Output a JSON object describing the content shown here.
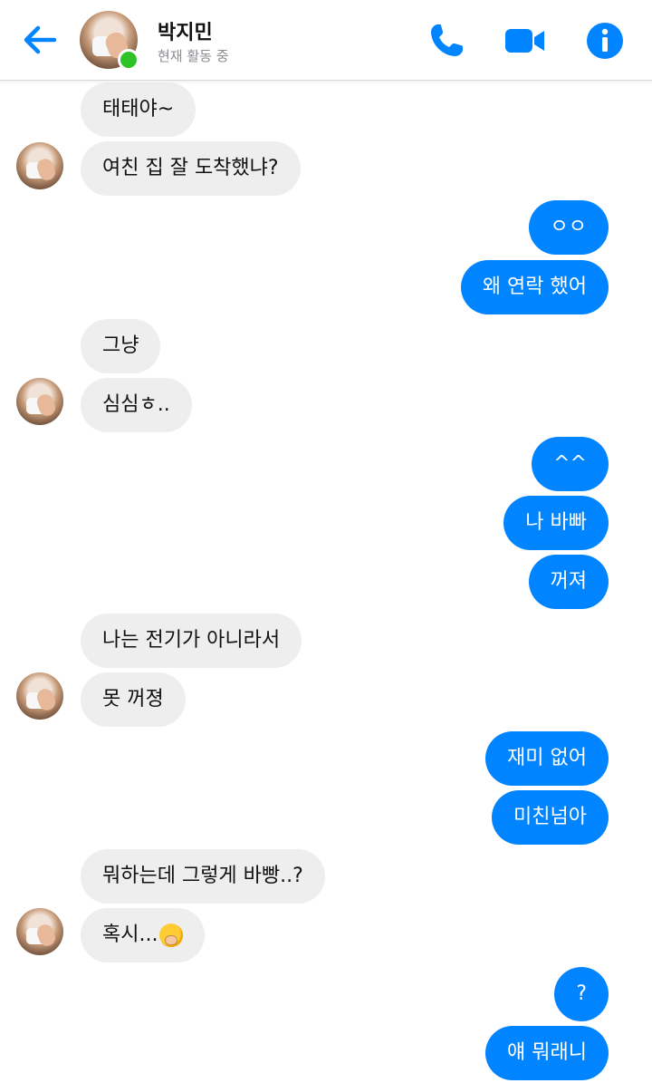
{
  "header": {
    "contact_name": "박지민",
    "status": "현재 활동 중",
    "back_icon": "arrow-left-icon",
    "call_icon": "phone-icon",
    "video_icon": "video-camera-icon",
    "info_icon": "info-icon"
  },
  "colors": {
    "accent": "#0084ff",
    "received_bubble": "#eeeeee",
    "online": "#2ec227"
  },
  "messages": [
    {
      "side": "received",
      "text": "태태야~"
    },
    {
      "side": "received",
      "text": "여친 집 잘 도착했냐?"
    },
    {
      "side": "sent",
      "text": "ㅇㅇ"
    },
    {
      "side": "sent",
      "text": "왜 연락 했어"
    },
    {
      "side": "received",
      "text": "그냥"
    },
    {
      "side": "received",
      "text": "심심ㅎ.."
    },
    {
      "side": "sent",
      "text": "^^"
    },
    {
      "side": "sent",
      "text": "나 바빠"
    },
    {
      "side": "sent",
      "text": "꺼져"
    },
    {
      "side": "received",
      "text": "나는 전기가 아니라서"
    },
    {
      "side": "received",
      "text": "못 꺼졍"
    },
    {
      "side": "sent",
      "text": "재미 없어"
    },
    {
      "side": "sent",
      "text": "미친넘아"
    },
    {
      "side": "received",
      "text": "뭐하는데 그렇게 바빵..?"
    },
    {
      "side": "received",
      "text": "혹시...",
      "emoji": "face-with-hand-over-mouth-emoji"
    },
    {
      "side": "sent",
      "text": "?"
    },
    {
      "side": "sent",
      "text": "얘 뭐래니"
    }
  ]
}
